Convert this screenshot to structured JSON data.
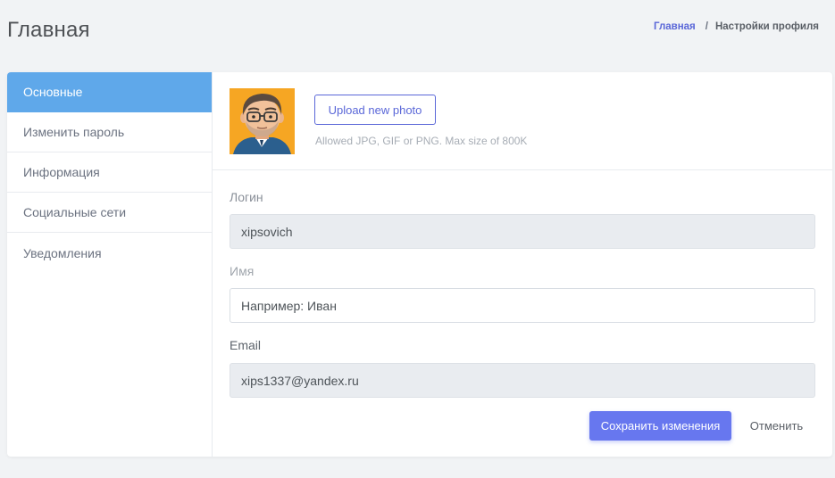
{
  "header": {
    "title": "Главная",
    "breadcrumb": {
      "home": "Главная",
      "separator": "/",
      "current": "Настройки профиля"
    }
  },
  "sidebar": {
    "items": [
      {
        "label": "Основные",
        "active": true
      },
      {
        "label": "Изменить пароль"
      },
      {
        "label": "Информация"
      },
      {
        "label": "Социальные сети"
      },
      {
        "label": "Уведомления"
      }
    ]
  },
  "photo": {
    "upload_label": "Upload new photo",
    "hint": "Allowed JPG, GIF or PNG. Max size of 800K"
  },
  "form": {
    "login_label": "Логин",
    "login_value": "xipsovich",
    "name_label": "Имя",
    "name_placeholder": "Например: Иван",
    "email_label": "Email",
    "email_value": "xips1337@yandex.ru"
  },
  "actions": {
    "save_label": "Сохранить изменения",
    "cancel_label": "Отменить"
  },
  "colors": {
    "accent": "#6777ef",
    "sidebar_active": "#5fa8ea",
    "link": "#5a67d8"
  },
  "icons": {
    "avatar": "cartoon-man-avatar"
  }
}
